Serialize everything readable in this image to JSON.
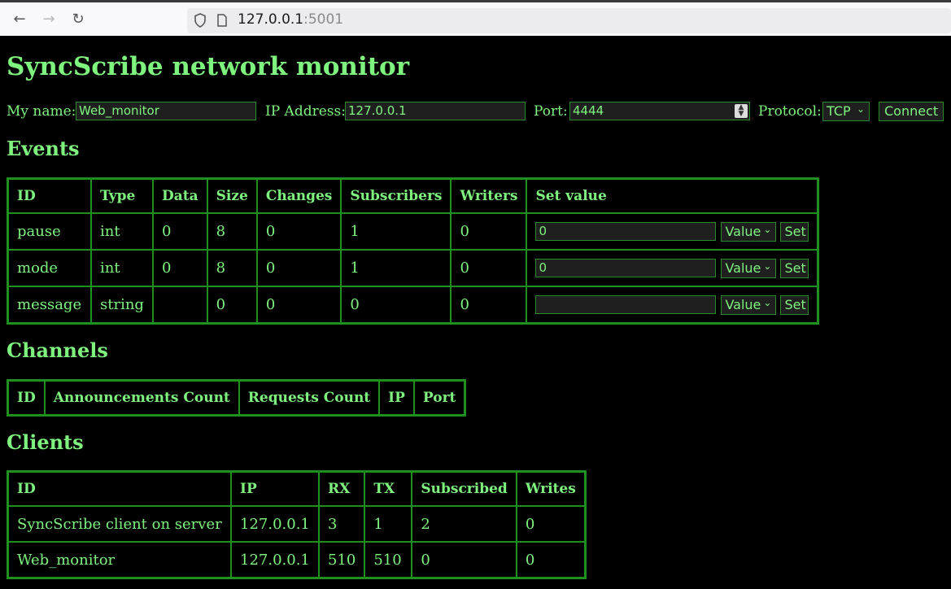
{
  "browser": {
    "url_host": "127.0.0.1",
    "url_port": ":5001"
  },
  "page": {
    "title": "SyncScribe network monitor"
  },
  "connection": {
    "name_label": "My name:",
    "name_value": "Web_monitor",
    "ip_label": "IP Address:",
    "ip_value": "127.0.0.1",
    "port_label": "Port:",
    "port_value": "4444",
    "protocol_label": "Protocol:",
    "protocol_value": "TCP",
    "connect_label": "Connect"
  },
  "events": {
    "heading": "Events",
    "columns": [
      "ID",
      "Type",
      "Data",
      "Size",
      "Changes",
      "Subscribers",
      "Writers",
      "Set value"
    ],
    "rows": [
      {
        "id": "pause",
        "type": "int",
        "data": "0",
        "size": "8",
        "changes": "0",
        "subscribers": "1",
        "writers": "0",
        "input": "0",
        "mode": "Value",
        "set": "Set"
      },
      {
        "id": "mode",
        "type": "int",
        "data": "0",
        "size": "8",
        "changes": "0",
        "subscribers": "1",
        "writers": "0",
        "input": "0",
        "mode": "Value",
        "set": "Set"
      },
      {
        "id": "message",
        "type": "string",
        "data": "",
        "size": "0",
        "changes": "0",
        "subscribers": "0",
        "writers": "0",
        "input": "",
        "mode": "Value",
        "set": "Set"
      }
    ]
  },
  "channels": {
    "heading": "Channels",
    "columns": [
      "ID",
      "Announcements Count",
      "Requests Count",
      "IP",
      "Port"
    ]
  },
  "clients": {
    "heading": "Clients",
    "columns": [
      "ID",
      "IP",
      "RX",
      "TX",
      "Subscribed",
      "Writes"
    ],
    "rows": [
      {
        "id": "SyncScribe client on server",
        "ip": "127.0.0.1",
        "rx": "3",
        "tx": "1",
        "subscribed": "2",
        "writes": "0"
      },
      {
        "id": "Web_monitor",
        "ip": "127.0.0.1",
        "rx": "510",
        "tx": "510",
        "subscribed": "0",
        "writes": "0"
      }
    ]
  }
}
